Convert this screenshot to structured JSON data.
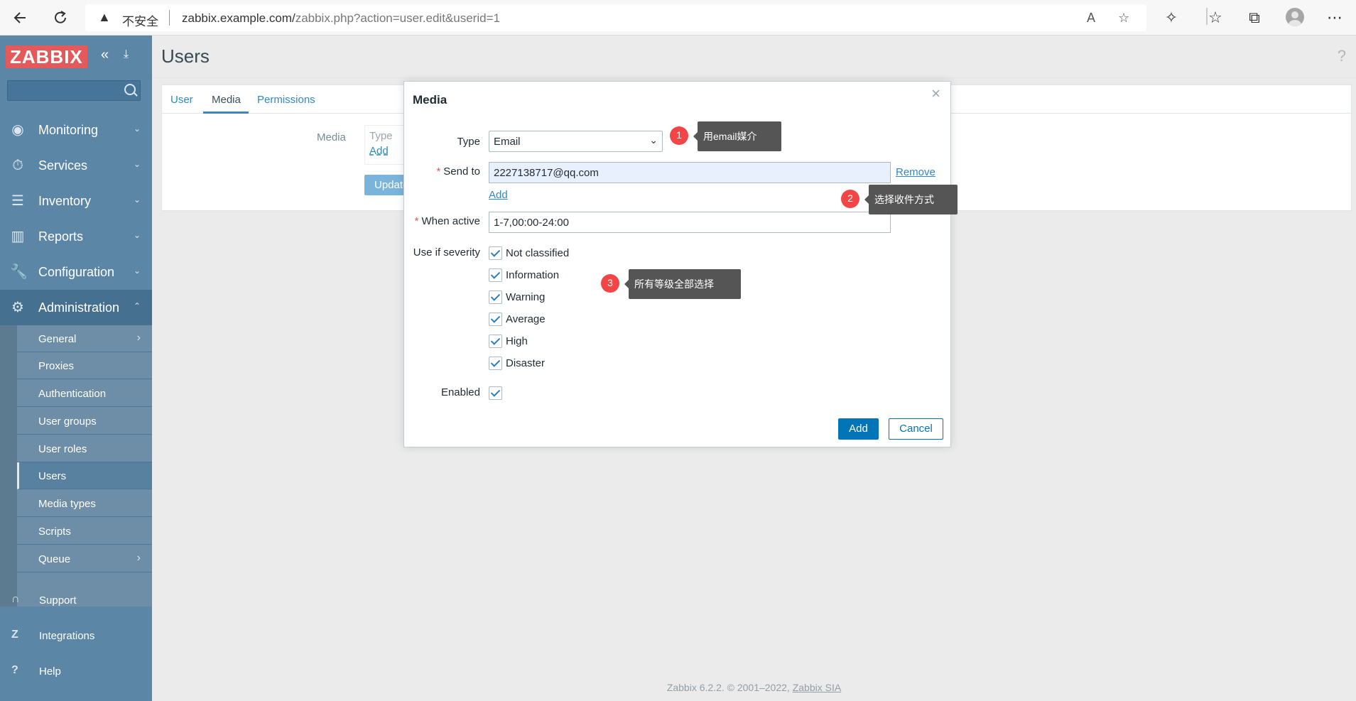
{
  "browser": {
    "insecure_label": "不安全",
    "url_host": "zabbix.example.com/",
    "url_path": "zabbix.php?action=user.edit&userid=1"
  },
  "sidebar": {
    "logo": "ZABBIX",
    "nav": [
      {
        "label": "Monitoring",
        "icon": "eye-icon"
      },
      {
        "label": "Services",
        "icon": "stopwatch-icon"
      },
      {
        "label": "Inventory",
        "icon": "list-icon"
      },
      {
        "label": "Reports",
        "icon": "bar-chart-icon"
      },
      {
        "label": "Configuration",
        "icon": "wrench-icon"
      },
      {
        "label": "Administration",
        "icon": "gear-icon"
      }
    ],
    "admin_sub": [
      {
        "label": "General"
      },
      {
        "label": "Proxies"
      },
      {
        "label": "Authentication"
      },
      {
        "label": "User groups"
      },
      {
        "label": "User roles"
      },
      {
        "label": "Users"
      },
      {
        "label": "Media types"
      },
      {
        "label": "Scripts"
      },
      {
        "label": "Queue"
      }
    ],
    "bottom": [
      {
        "label": "Support",
        "icon": "headset-icon"
      },
      {
        "label": "Integrations",
        "icon": "z-icon"
      },
      {
        "label": "Help",
        "icon": "question-icon"
      }
    ]
  },
  "page": {
    "title": "Users",
    "tabs": [
      "User",
      "Media",
      "Permissions"
    ],
    "media_label": "Media",
    "media_table_header": "Type",
    "media_add": "Add",
    "update_button": "Update",
    "footer_text": "Zabbix 6.2.2. © 2001–2022, ",
    "footer_link": "Zabbix SIA"
  },
  "modal": {
    "title": "Media",
    "type_label": "Type",
    "type_value": "Email",
    "send_to_label": "Send to",
    "send_to_value": "2227138717@qq.com",
    "remove_link": "Remove",
    "add_link": "Add",
    "when_active_label": "When active",
    "when_active_value": "1-7,00:00-24:00",
    "severity_label": "Use if severity",
    "severities": [
      "Not classified",
      "Information",
      "Warning",
      "Average",
      "High",
      "Disaster"
    ],
    "enabled_label": "Enabled",
    "add_button": "Add",
    "cancel_button": "Cancel"
  },
  "annotations": [
    {
      "number": "1",
      "text": "用email媒介"
    },
    {
      "number": "2",
      "text": "选择收件方式"
    },
    {
      "number": "3",
      "text": "所有等级全部选择"
    }
  ],
  "colors": {
    "sidebar_bg": "#5b86a6",
    "logo_bg": "#e45959",
    "link": "#2f8ac4",
    "primary_button": "#0275b8",
    "annotation_marker": "#f24545",
    "annotation_tip": "#555555"
  }
}
